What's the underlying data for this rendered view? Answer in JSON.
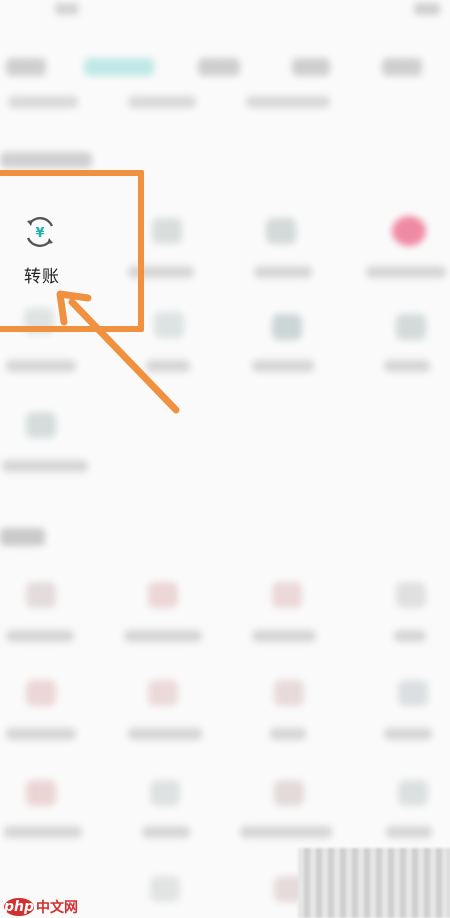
{
  "highlighted_item": {
    "label": "转账",
    "icon": "yuan-transfer-icon"
  },
  "watermark": {
    "mark": "php",
    "text": "中文网"
  },
  "colors": {
    "highlight": "#f0913f",
    "accent_teal": "#20b2aa",
    "watermark_red": "#d32f2f"
  }
}
